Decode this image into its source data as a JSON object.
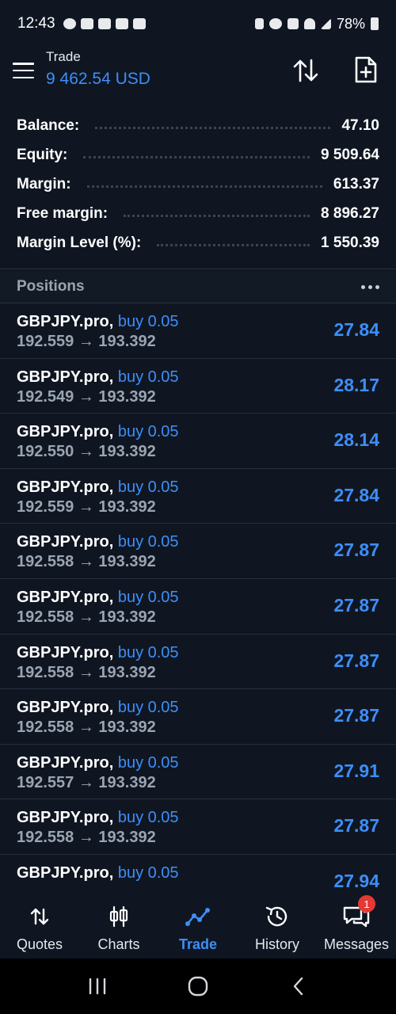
{
  "status_bar": {
    "time": "12:43",
    "battery": "78%"
  },
  "header": {
    "title": "Trade",
    "balance_display": "9 462.54 USD"
  },
  "summary": [
    {
      "label": "Balance:",
      "value": "47.10"
    },
    {
      "label": "Equity:",
      "value": "9 509.64"
    },
    {
      "label": "Margin:",
      "value": "613.37"
    },
    {
      "label": "Free margin:",
      "value": "8 896.27"
    },
    {
      "label": "Margin Level (%):",
      "value": "1 550.39"
    }
  ],
  "positions": {
    "title": "Positions",
    "items": [
      {
        "symbol": "GBPJPY.pro,",
        "side": "buy 0.05",
        "prices": "192.559 → 193.392",
        "profit": "27.84"
      },
      {
        "symbol": "GBPJPY.pro,",
        "side": "buy 0.05",
        "prices": "192.549 → 193.392",
        "profit": "28.17"
      },
      {
        "symbol": "GBPJPY.pro,",
        "side": "buy 0.05",
        "prices": "192.550 → 193.392",
        "profit": "28.14"
      },
      {
        "symbol": "GBPJPY.pro,",
        "side": "buy 0.05",
        "prices": "192.559 → 193.392",
        "profit": "27.84"
      },
      {
        "symbol": "GBPJPY.pro,",
        "side": "buy 0.05",
        "prices": "192.558 → 193.392",
        "profit": "27.87"
      },
      {
        "symbol": "GBPJPY.pro,",
        "side": "buy 0.05",
        "prices": "192.558 → 193.392",
        "profit": "27.87"
      },
      {
        "symbol": "GBPJPY.pro,",
        "side": "buy 0.05",
        "prices": "192.558 → 193.392",
        "profit": "27.87"
      },
      {
        "symbol": "GBPJPY.pro,",
        "side": "buy 0.05",
        "prices": "192.558 → 193.392",
        "profit": "27.87"
      },
      {
        "symbol": "GBPJPY.pro,",
        "side": "buy 0.05",
        "prices": "192.557 → 193.392",
        "profit": "27.91"
      },
      {
        "symbol": "GBPJPY.pro,",
        "side": "buy 0.05",
        "prices": "192.558 → 193.392",
        "profit": "27.87"
      },
      {
        "symbol": "GBPJPY.pro,",
        "side": "buy 0.05",
        "prices": "",
        "profit": "27.94"
      }
    ]
  },
  "bottom_nav": {
    "items": [
      {
        "label": "Quotes",
        "icon": "quotes-icon"
      },
      {
        "label": "Charts",
        "icon": "charts-icon"
      },
      {
        "label": "Trade",
        "icon": "trade-icon",
        "active": true
      },
      {
        "label": "History",
        "icon": "history-icon"
      },
      {
        "label": "Messages",
        "icon": "messages-icon",
        "badge": "1"
      }
    ]
  },
  "colors": {
    "background": "#0f1622",
    "accent": "#3e8ef7",
    "muted": "#9aa4b2",
    "badge": "#e53935"
  }
}
